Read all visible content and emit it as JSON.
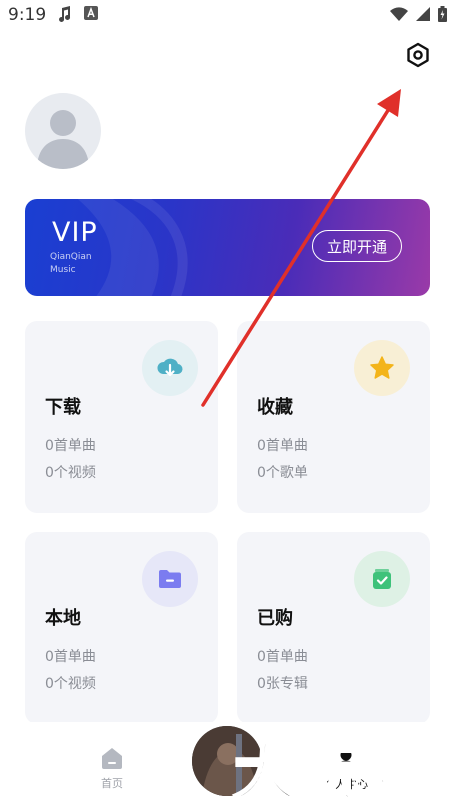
{
  "status_bar": {
    "time": "9:19",
    "icons": [
      "music-note-icon",
      "a-badge-icon",
      "wifi-icon",
      "signal-icon",
      "battery-icon"
    ]
  },
  "vip": {
    "title": "VIP",
    "subtitle": "QianQian Music",
    "button": "立即开通"
  },
  "cards": [
    {
      "title": "下载",
      "line1": "0首单曲",
      "line2": "0个视频",
      "icon": "cloud-download-icon",
      "icon_color": "#4fb0c6",
      "icon_bg": "#e3f0f3"
    },
    {
      "title": "收藏",
      "line1": "0首单曲",
      "line2": "0个歌单",
      "icon": "star-icon",
      "icon_color": "#f3b41a",
      "icon_bg": "#f8efd5"
    },
    {
      "title": "本地",
      "line1": "0首单曲",
      "line2": "0个视频",
      "icon": "folder-icon",
      "icon_color": "#7b7cf0",
      "icon_bg": "#e6e7f8"
    },
    {
      "title": "已购",
      "line1": "0首单曲",
      "line2": "0张专辑",
      "icon": "bag-check-icon",
      "icon_color": "#3ec27a",
      "icon_bg": "#def1e5"
    }
  ],
  "nav": {
    "home_label": "首页",
    "profile_label": "个人中心"
  },
  "watermark": "大玩客",
  "colors": {
    "vip_gradient_start": "#1a3fd2",
    "vip_gradient_end": "#9a3aa8",
    "arrow": "#e0302a"
  }
}
